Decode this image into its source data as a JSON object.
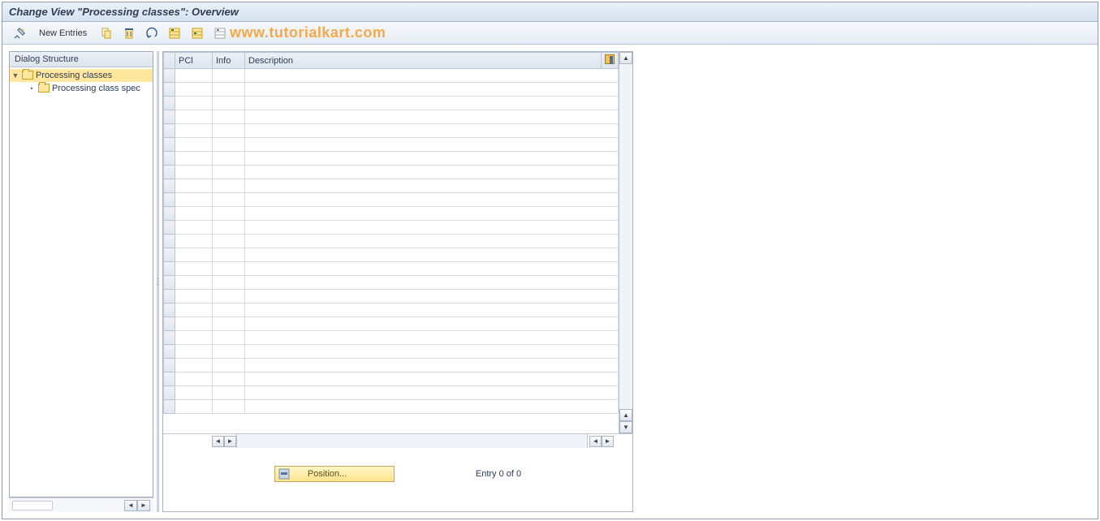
{
  "title": "Change View \"Processing classes\": Overview",
  "toolbar": {
    "new_entries_label": "New Entries"
  },
  "watermark": "www.tutorialkart.com",
  "tree": {
    "header": "Dialog Structure",
    "nodes": [
      {
        "label": "Processing classes",
        "selected": true,
        "expanded": true,
        "level": 1,
        "icon": "folder-open"
      },
      {
        "label": "Processing class spec",
        "selected": false,
        "expanded": false,
        "level": 2,
        "icon": "folder-closed"
      }
    ]
  },
  "table": {
    "columns": {
      "pcl": "PCl",
      "info": "Info",
      "description": "Description"
    },
    "row_count": 25
  },
  "footer": {
    "position_label": "Position...",
    "entry_text": "Entry 0 of 0"
  }
}
